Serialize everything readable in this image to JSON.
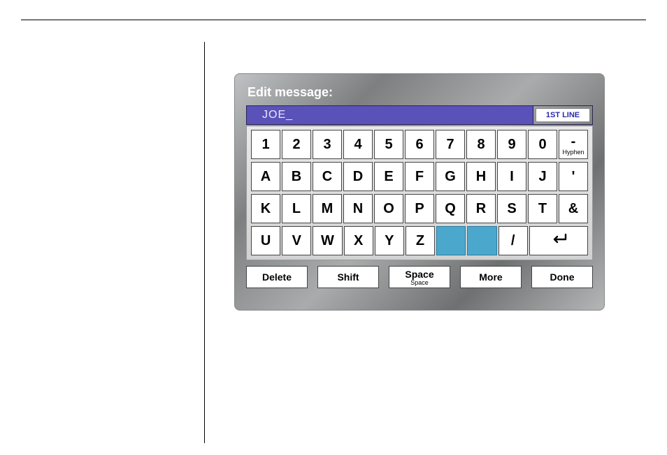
{
  "screen": {
    "title": "Edit message:",
    "input_value": "JOE_",
    "line_badge": "1ST LINE"
  },
  "keyboard": {
    "rows": [
      [
        {
          "label": "1"
        },
        {
          "label": "2"
        },
        {
          "label": "3"
        },
        {
          "label": "4"
        },
        {
          "label": "5"
        },
        {
          "label": "6"
        },
        {
          "label": "7"
        },
        {
          "label": "8"
        },
        {
          "label": "9"
        },
        {
          "label": "0"
        },
        {
          "label": "-",
          "sublabel": "Hyphen"
        }
      ],
      [
        {
          "label": "A"
        },
        {
          "label": "B"
        },
        {
          "label": "C"
        },
        {
          "label": "D"
        },
        {
          "label": "E"
        },
        {
          "label": "F"
        },
        {
          "label": "G"
        },
        {
          "label": "H"
        },
        {
          "label": "I"
        },
        {
          "label": "J"
        },
        {
          "label": "'"
        }
      ],
      [
        {
          "label": "K"
        },
        {
          "label": "L"
        },
        {
          "label": "M"
        },
        {
          "label": "N"
        },
        {
          "label": "O"
        },
        {
          "label": "P"
        },
        {
          "label": "Q"
        },
        {
          "label": "R"
        },
        {
          "label": "S"
        },
        {
          "label": "T"
        },
        {
          "label": "&"
        }
      ],
      [
        {
          "label": "U"
        },
        {
          "label": "V"
        },
        {
          "label": "W"
        },
        {
          "label": "X"
        },
        {
          "label": "Y"
        },
        {
          "label": "Z"
        },
        {
          "label": "",
          "blue": true
        },
        {
          "label": "",
          "blue": true
        },
        {
          "label": "/"
        },
        {
          "label": "↵",
          "wide": true,
          "enter": true
        }
      ]
    ],
    "fn_keys": [
      {
        "label": "Delete"
      },
      {
        "label": "Shift"
      },
      {
        "label": "Space",
        "sublabel": "Space"
      },
      {
        "label": "More"
      },
      {
        "label": "Done"
      }
    ]
  }
}
